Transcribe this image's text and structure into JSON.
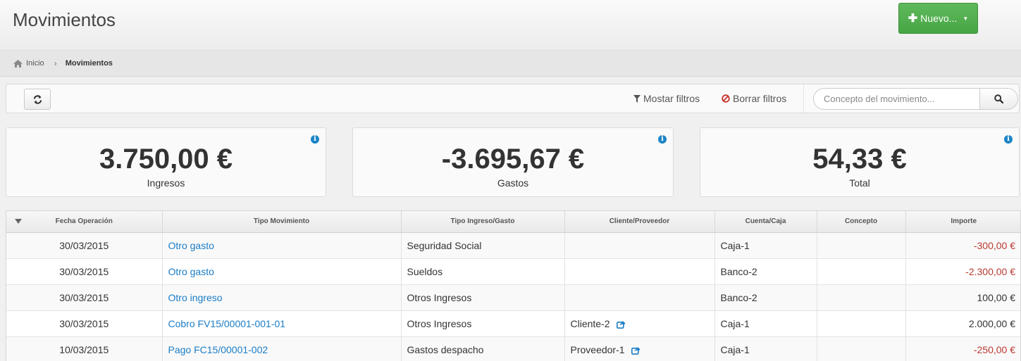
{
  "header": {
    "title": "Movimientos",
    "new_button_label": "Nuevo..."
  },
  "breadcrumb": {
    "home": "Inicio",
    "current": "Movimientos"
  },
  "toolbar": {
    "show_filters": "Mostar filtros",
    "clear_filters": "Borrar filtros",
    "search_placeholder": "Concepto del movimiento..."
  },
  "stats": [
    {
      "value": "3.750,00 €",
      "label": "Ingresos"
    },
    {
      "value": "-3.695,67 €",
      "label": "Gastos"
    },
    {
      "value": "54,33 €",
      "label": "Total"
    }
  ],
  "table": {
    "columns": [
      "Fecha Operación",
      "Tipo Movimiento",
      "Tipo Ingreso/Gasto",
      "Cliente/Proveedor",
      "Cuenta/Caja",
      "Concepto",
      "Importe"
    ],
    "rows": [
      {
        "fecha": "30/03/2015",
        "tipo": "Otro gasto",
        "ingreso_gasto": "Seguridad Social",
        "cliente": "",
        "cuenta": "Caja-1",
        "concepto": "",
        "importe": "-300,00 €"
      },
      {
        "fecha": "30/03/2015",
        "tipo": "Otro gasto",
        "ingreso_gasto": "Sueldos",
        "cliente": "",
        "cuenta": "Banco-2",
        "concepto": "",
        "importe": "-2.300,00 €"
      },
      {
        "fecha": "30/03/2015",
        "tipo": "Otro ingreso",
        "ingreso_gasto": "Otros Ingresos",
        "cliente": "",
        "cuenta": "Banco-2",
        "concepto": "",
        "importe": "100,00 €"
      },
      {
        "fecha": "30/03/2015",
        "tipo": "Cobro FV15/00001-001-01",
        "ingreso_gasto": "Otros Ingresos",
        "cliente": "Cliente-2",
        "cuenta": "Caja-1",
        "concepto": "",
        "importe": "2.000,00 €"
      },
      {
        "fecha": "10/03/2015",
        "tipo": "Pago FC15/00001-002",
        "ingreso_gasto": "Gastos despacho",
        "cliente": "Proveedor-1",
        "cuenta": "Caja-1",
        "concepto": "",
        "importe": "-250,00 €"
      }
    ]
  },
  "colors": {
    "accent": "#1b7dc6",
    "new_button": "#47a544",
    "negative": "#b83b32",
    "info": "#1c84c6"
  },
  "icons": {
    "home": "home-icon",
    "refresh": "refresh-icon",
    "filter": "filter-icon",
    "clear": "ban-icon",
    "search": "search-icon",
    "info": "info-icon",
    "external": "external-link-icon"
  }
}
